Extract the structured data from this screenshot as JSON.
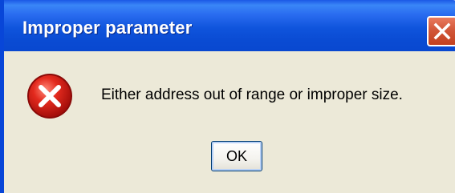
{
  "window": {
    "title": "Improper parameter",
    "close_icon": "close-icon",
    "title_bar_color": "#0a4bd3",
    "close_button_color": "#d2573a"
  },
  "dialog": {
    "icon": "error-icon",
    "icon_color": "#e02020",
    "message": "Either address out of range or improper size.",
    "ok_label": "OK",
    "background_color": "#ece9d8"
  }
}
